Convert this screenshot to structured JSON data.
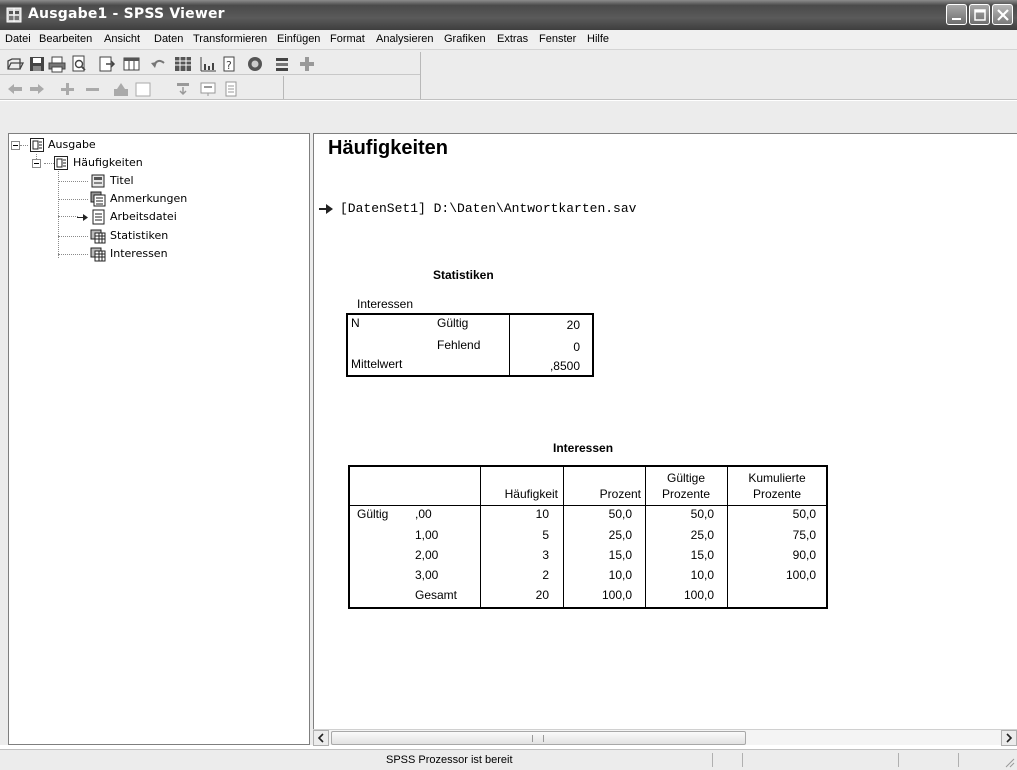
{
  "window": {
    "title": "Ausgabe1 - SPSS Viewer"
  },
  "menu": {
    "items": [
      {
        "label": "Datei"
      },
      {
        "label": "Bearbeiten"
      },
      {
        "label": "Ansicht"
      },
      {
        "label": "Daten"
      },
      {
        "label": "Transformieren"
      },
      {
        "label": "Einfügen"
      },
      {
        "label": "Format"
      },
      {
        "label": "Analysieren"
      },
      {
        "label": "Grafiken"
      },
      {
        "label": "Extras"
      },
      {
        "label": "Fenster"
      },
      {
        "label": "Hilfe"
      }
    ]
  },
  "toolbar": {
    "row1_icons": [
      "open-icon",
      "save-icon",
      "print-icon",
      "print-preview-icon",
      "export-icon",
      "goto-data-icon",
      "undo-icon",
      "variables-icon",
      "chart-icon",
      "help-pointer-icon",
      "designate-window-icon",
      "insert-icon",
      "add-icon"
    ],
    "row2_icons": [
      "promote-icon",
      "demote-icon",
      "expand-icon",
      "collapse-icon",
      "show-icon",
      "hide-icon",
      "insert-heading-icon",
      "insert-title-icon",
      "insert-text-icon"
    ]
  },
  "outline": {
    "root": "Ausgabe",
    "procedure": "Häufigkeiten",
    "children": [
      "Titel",
      "Anmerkungen",
      "Arbeitsdatei",
      "Statistiken",
      "Interessen"
    ]
  },
  "output": {
    "heading": "Häufigkeiten",
    "dataset": "[DatenSet1] D:\\Daten\\Antwortkarten.sav",
    "statistics_table": {
      "title": "Statistiken",
      "variable": "Interessen",
      "rows": [
        {
          "label1": "N",
          "label2": "Gültig",
          "value": "20"
        },
        {
          "label1": "",
          "label2": "Fehlend",
          "value": "0"
        },
        {
          "label1": "Mittelwert",
          "label2": "",
          "value": ",8500"
        }
      ]
    },
    "frequency_table": {
      "title": "Interessen",
      "headers": [
        "Häufigkeit",
        "Prozent",
        "Gültige Prozente",
        "Kumulierte Prozente"
      ],
      "header_lines": {
        "gueltige_1": "Gültige",
        "gueltige_2": "Prozente",
        "kumulierte_1": "Kumulierte",
        "kumulierte_2": "Prozente"
      },
      "group_label": "Gültig",
      "rows": [
        {
          "category": ",00",
          "freq": "10",
          "pct": "50,0",
          "valid_pct": "50,0",
          "cum_pct": "50,0"
        },
        {
          "category": "1,00",
          "freq": "5",
          "pct": "25,0",
          "valid_pct": "25,0",
          "cum_pct": "75,0"
        },
        {
          "category": "2,00",
          "freq": "3",
          "pct": "15,0",
          "valid_pct": "15,0",
          "cum_pct": "90,0"
        },
        {
          "category": "3,00",
          "freq": "2",
          "pct": "10,0",
          "valid_pct": "10,0",
          "cum_pct": "100,0"
        },
        {
          "category": "Gesamt",
          "freq": "20",
          "pct": "100,0",
          "valid_pct": "100,0",
          "cum_pct": ""
        }
      ]
    }
  },
  "status": {
    "text": "SPSS Prozessor ist bereit"
  }
}
